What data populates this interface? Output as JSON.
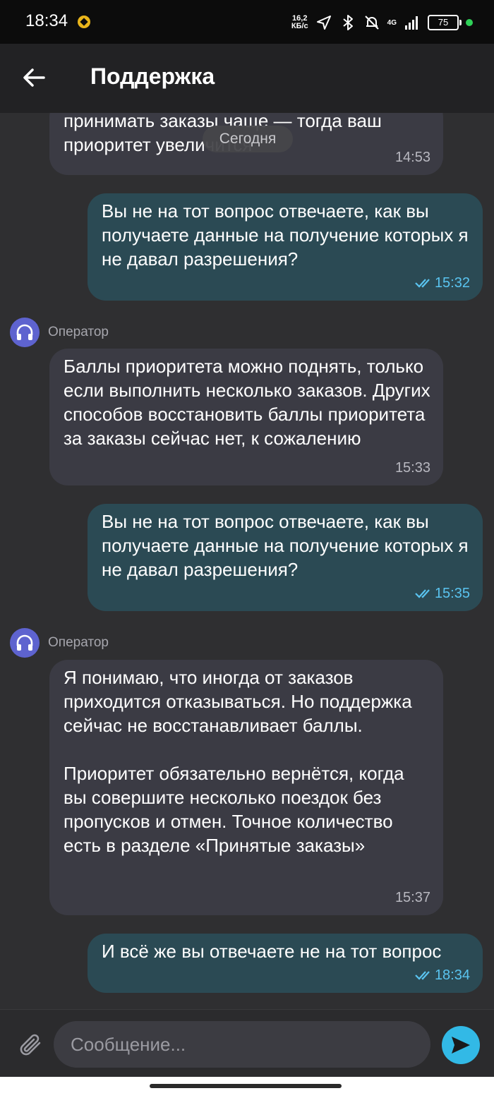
{
  "status_bar": {
    "time": "18:34",
    "speed_value": "16,2",
    "speed_unit": "КБ/с",
    "network": "4G",
    "battery": "75"
  },
  "header": {
    "title": "Поддержка",
    "back_icon": "arrow-left-icon"
  },
  "chat": {
    "date_separator": "Сегодня",
    "partial_message": {
      "text": "принимать заказы чаще — тогда ваш\nприоритет увеличится",
      "time": "14:53"
    },
    "messages": [
      {
        "from": "me",
        "text": "Вы не на тот вопрос отвечаете, как вы получаете данные на получение которых я не давал разрешения?",
        "time": "15:32"
      },
      {
        "from": "operator",
        "sender": "Оператор",
        "text": "Баллы приоритета можно поднять, только если выполнить несколько заказов. Других способов восстановить баллы приоритета за заказы сейчас нет, к сожалению",
        "time": "15:33"
      },
      {
        "from": "me",
        "text": "Вы не на тот вопрос отвечаете, как вы получаете данные на получение которых я не давал разрешения?",
        "time": "15:35"
      },
      {
        "from": "operator",
        "sender": "Оператор",
        "text": "Я понимаю, что иногда от заказов приходится отказываться. Но поддержка сейчас не восстанавливает баллы.\n\nПриоритет обязательно вернётся, когда вы совершите несколько поездок без пропусков и отмен. Точное количество есть в разделе «Принятые заказы»",
        "time": "15:37"
      },
      {
        "from": "me",
        "text": "И всё же вы отвечаете не на тот вопрос",
        "time": "18:34"
      }
    ]
  },
  "composer": {
    "placeholder": "Сообщение...",
    "attach_icon": "paperclip-icon",
    "send_icon": "send-icon"
  },
  "colors": {
    "background": "#2f2f31",
    "operator_bubble": "#3b3b44",
    "user_bubble": "#2b4a54",
    "read_check": "#5ac4f0",
    "accent": "#32b9e6",
    "avatar": "#5e63cf"
  }
}
